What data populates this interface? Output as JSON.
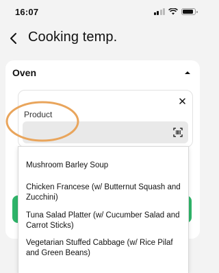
{
  "status_bar": {
    "time": "16:07"
  },
  "header": {
    "title": "Cooking temp."
  },
  "oven": {
    "label": "Oven"
  },
  "product_panel": {
    "label": "Product",
    "input_value": "",
    "input_placeholder": ""
  },
  "dropdown": {
    "options": [
      {
        "label": "Mushroom Barley Soup"
      },
      {
        "label": "Chicken Francese (w/ Butternut Squash and Zucchini)"
      },
      {
        "label": "Tuna Salad Platter (w/ Cucumber Salad and Carrot Sticks)"
      },
      {
        "label": "Vegetarian Stuffed Cabbage (w/ Rice Pilaf and Green Beans)"
      }
    ]
  },
  "colors": {
    "accent_green": "#2fb56a",
    "highlight_orange": "#e9a55c"
  },
  "icons": [
    "signal-icon",
    "wifi-icon",
    "battery-icon",
    "back-arrow-icon",
    "chevron-up-icon",
    "close-icon",
    "barcode-scan-icon"
  ]
}
